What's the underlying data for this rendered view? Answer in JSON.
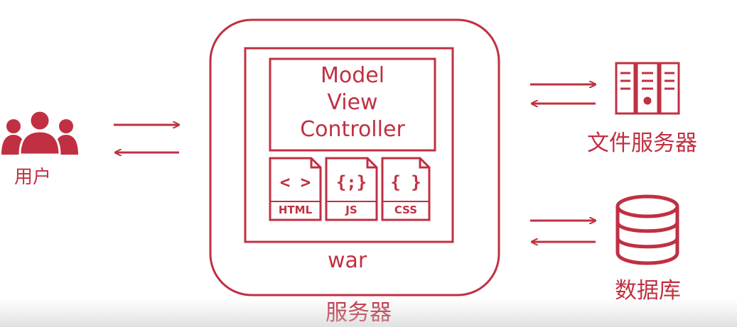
{
  "colors": {
    "accent": "#c03042",
    "background": "#ffffff"
  },
  "user": {
    "label": "用户",
    "icon": "users-icon"
  },
  "server": {
    "label": "服务器",
    "war": {
      "label": "war",
      "mvc_lines": [
        "Model",
        "View",
        "Controller"
      ],
      "files": [
        {
          "symbol": "< >",
          "name": "HTML",
          "icon": "html-file-icon"
        },
        {
          "symbol": "{;}",
          "name": "JS",
          "icon": "js-file-icon"
        },
        {
          "symbol": "{ }",
          "name": "CSS",
          "icon": "css-file-icon"
        }
      ]
    }
  },
  "file_server": {
    "label": "文件服务器",
    "icon": "file-server-icon"
  },
  "database": {
    "label": "数据库",
    "icon": "database-icon"
  }
}
